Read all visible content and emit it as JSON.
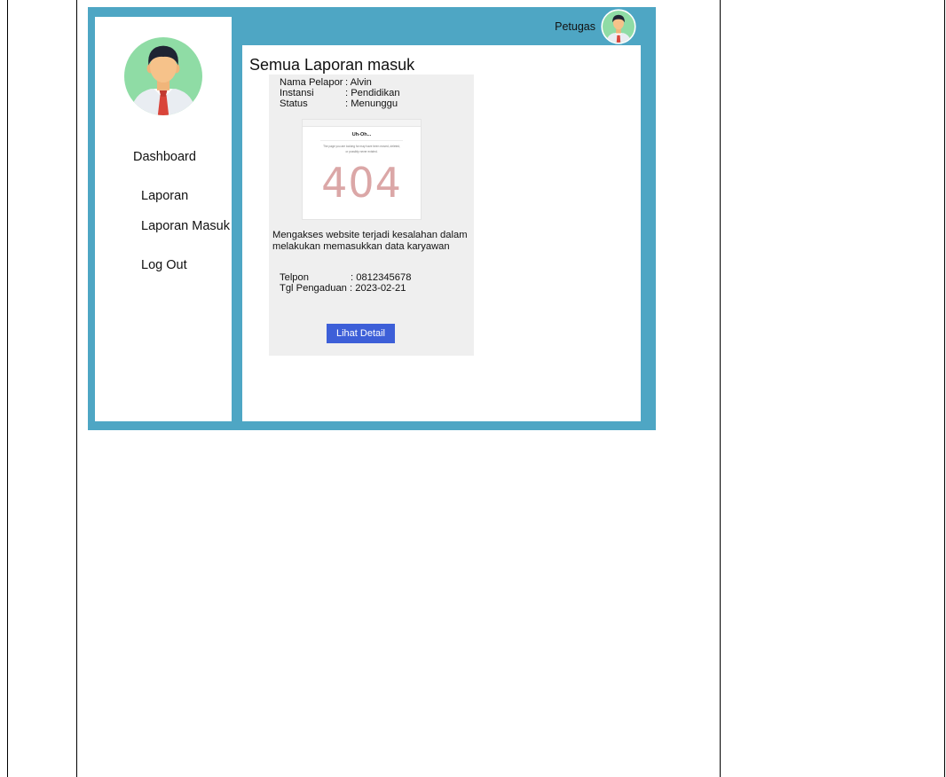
{
  "topbar": {
    "user_label": "Petugas"
  },
  "sidebar": {
    "items": [
      {
        "label": "Dashboard"
      },
      {
        "label": "Laporan"
      },
      {
        "label": "Laporan Masuk"
      },
      {
        "label": "Log Out"
      }
    ]
  },
  "main": {
    "title": "Semua Laporan masuk",
    "report": {
      "rows": [
        {
          "key": "Nama Pelapor",
          "value": ": Alvin"
        },
        {
          "key": "Instansi",
          "value": ": Pendidikan"
        },
        {
          "key": "Status",
          "value": ": Menunggu"
        }
      ],
      "screenshot": {
        "title": "Uh-Oh...",
        "message_1": "The page you are looking for may have been moved, deleted,",
        "message_2": "or possibly never existed.",
        "code": "404"
      },
      "description": "Mengakses website terjadi kesalahan dalam melakukan memasukkan data karyawan",
      "contact": [
        {
          "key": "Telpon",
          "value": ": 0812345678"
        },
        {
          "key": "Tgl Pengaduan",
          "value": ": 2023-02-21"
        }
      ],
      "detail_button": "Lihat Detail"
    }
  },
  "colors": {
    "frame": "#4ea6c4",
    "card": "#efefef",
    "button": "#3d5fd8",
    "avatar_bg": "#8fdca5"
  },
  "icons": {
    "profile_large": "user-avatar-icon",
    "profile_small": "user-avatar-icon"
  }
}
